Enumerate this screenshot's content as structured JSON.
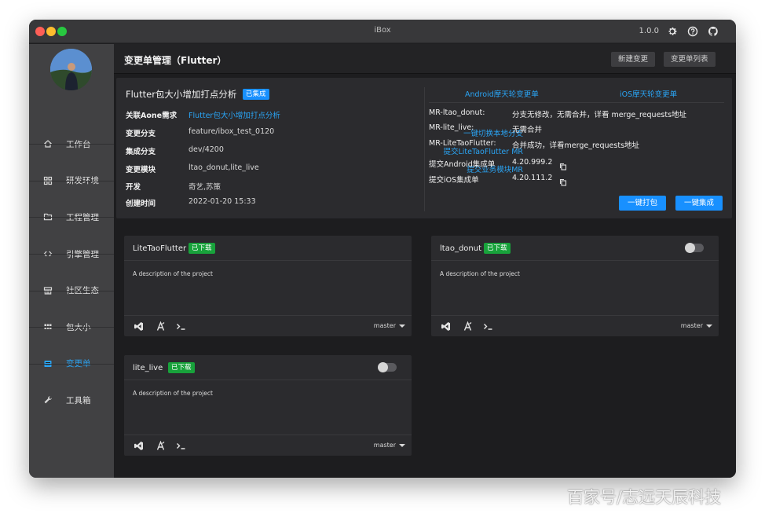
{
  "window": {
    "title": "iBox",
    "version": "1.0.0"
  },
  "titlebar_icons": [
    "gear-icon",
    "help-icon",
    "github-icon"
  ],
  "sidebar": {
    "items": [
      {
        "label": "工作台",
        "icon": "home-icon",
        "active": false
      },
      {
        "label": "研发环境",
        "icon": "grid-icon",
        "active": false
      },
      {
        "label": "工程管理",
        "icon": "folder-icon",
        "active": false
      },
      {
        "label": "引擎管理",
        "icon": "code-icon",
        "active": false
      },
      {
        "label": "社区生态",
        "icon": "store-icon",
        "active": false
      },
      {
        "label": "包大小",
        "icon": "apps-icon",
        "active": false
      },
      {
        "label": "变更单",
        "icon": "list-icon",
        "active": true
      },
      {
        "label": "工具箱",
        "icon": "tools-icon",
        "active": false
      }
    ]
  },
  "header": {
    "title": "变更单管理（Flutter）",
    "new_button": "新建变更",
    "list_button": "变更单列表"
  },
  "info": {
    "title": "Flutter包大小增加打点分析",
    "badge": "已集成",
    "rows": [
      {
        "label": "关联Aone需求",
        "value": "Flutter包大小增加打点分析",
        "value_is_link": true,
        "action": ""
      },
      {
        "label": "变更分支",
        "value": "feature/ibox_test_0120",
        "value_is_link": false,
        "action": "一键切换本地分支"
      },
      {
        "label": "集成分支",
        "value": "dev/4200",
        "value_is_link": false,
        "action": "提交LiteTaoFlutter MR"
      },
      {
        "label": "变更模块",
        "value": "ltao_donut,lite_live",
        "value_is_link": false,
        "action": "提交业务模块MR"
      },
      {
        "label": "开发",
        "value": "奇艺,苏策",
        "value_is_link": false,
        "action": ""
      },
      {
        "label": "创建时间",
        "value": "2022-01-20 15:33",
        "value_is_link": false,
        "action": ""
      }
    ],
    "android_link": "Android摩天轮变更单",
    "ios_link": "iOS摩天轮变更单",
    "mr_rows": [
      {
        "label": "MR-ltao_donut:",
        "value": "分支无修改，无需合并，详看 merge_requests地址",
        "is_link": true
      },
      {
        "label": "MR-lite_live:",
        "value": "无需合并",
        "is_link": false
      },
      {
        "label": "MR-LiteTaoFlutter:",
        "value": "合并成功，详看merge_requests地址",
        "is_link": true
      }
    ],
    "submit_rows": [
      {
        "label": "提交Android集成单",
        "value": "4.20.999.2"
      },
      {
        "label": "提交iOS集成单",
        "value": "4.20.111.2"
      }
    ],
    "pack_button": "一键打包",
    "integrate_button": "一键集成"
  },
  "projects": [
    {
      "name": "LiteTaoFlutter",
      "badge": "已下载",
      "has_toggle": false,
      "description": "A description of the project",
      "branch": "master"
    },
    {
      "name": "ltao_donut",
      "badge": "已下载",
      "has_toggle": true,
      "description": "A description of the project",
      "branch": "master"
    },
    {
      "name": "lite_live",
      "badge": "已下载",
      "has_toggle": true,
      "description": "A description of the project",
      "branch": "master"
    }
  ],
  "watermark": "百家号/志远天辰科技",
  "colors": {
    "accent": "#1890ff",
    "link": "#2aa4f4",
    "success": "#18a23b",
    "sidebar_bg": "#414143",
    "main_bg": "#1d1d1f"
  }
}
